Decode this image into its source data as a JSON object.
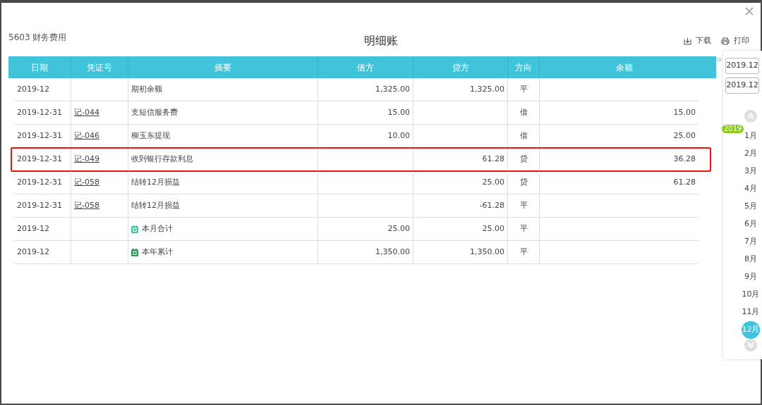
{
  "ledger": {
    "account": "5603 财务费用",
    "title": "明细账",
    "actions": [
      {
        "kind": "download",
        "label": "下载"
      },
      {
        "kind": "print",
        "label": "打印"
      }
    ]
  },
  "table": {
    "columns": [
      "日期",
      "凭证号",
      "摘要",
      "借方",
      "贷方",
      "方向",
      "余额"
    ],
    "rows": [
      {
        "kind": "opening",
        "date": "2019-12",
        "summary": "期初余额",
        "debit": "1,325.00",
        "credit": "1,325.00",
        "direction": "平",
        "highlighted": false
      },
      {
        "kind": "entry",
        "date": "2019-12-31",
        "voucher": "记-044",
        "summary": "支短信服务费",
        "debit": "15.00",
        "direction": "借",
        "balance": "15.00",
        "highlighted": false
      },
      {
        "kind": "entry",
        "date": "2019-12-31",
        "voucher": "记-046",
        "summary": "柳玉东提现",
        "debit": "10.00",
        "direction": "借",
        "balance": "25.00",
        "highlighted": false
      },
      {
        "kind": "entry",
        "date": "2019-12-31",
        "voucher": "记-049",
        "summary": "收到银行存款利息",
        "credit": "61.28",
        "direction": "贷",
        "balance": "36.28",
        "highlighted": true
      },
      {
        "kind": "entry",
        "date": "2019-12-31",
        "voucher": "记-058",
        "summary": "结转12月损益",
        "credit": "25.00",
        "direction": "贷",
        "balance": "61.28",
        "highlighted": false
      },
      {
        "kind": "entry",
        "date": "2019-12-31",
        "voucher": "记-058",
        "summary": "结转12月损益",
        "credit": "-61.28",
        "direction": "平",
        "highlighted": false
      },
      {
        "kind": "month_total",
        "date": "2019-12",
        "summary": "本月合计",
        "debit": "25.00",
        "credit": "25.00",
        "direction": "平",
        "highlighted": false
      },
      {
        "kind": "year_total",
        "date": "2019-12",
        "summary": "本年累计",
        "debit": "1,350.00",
        "credit": "1,350.00",
        "direction": "平",
        "highlighted": false
      }
    ]
  },
  "period_panel": {
    "collapse": "»",
    "start": "2019.12",
    "end": "2019.12",
    "year": "2019",
    "months": [
      {
        "label": "1月",
        "selected": false
      },
      {
        "label": "2月",
        "selected": false
      },
      {
        "label": "3月",
        "selected": false
      },
      {
        "label": "4月",
        "selected": false
      },
      {
        "label": "5月",
        "selected": false
      },
      {
        "label": "6月",
        "selected": false
      },
      {
        "label": "7月",
        "selected": false
      },
      {
        "label": "8月",
        "selected": false
      },
      {
        "label": "9月",
        "selected": false
      },
      {
        "label": "10月",
        "selected": false
      },
      {
        "label": "11月",
        "selected": false
      },
      {
        "label": "12月",
        "selected": true
      }
    ]
  }
}
